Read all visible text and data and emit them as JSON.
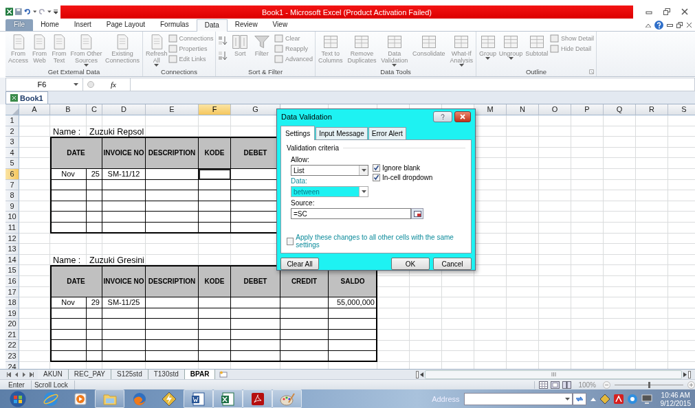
{
  "window": {
    "title": "Book1 - Microsoft Excel (Product Activation Failed)"
  },
  "ribbon": {
    "disabled": true,
    "tabs": [
      {
        "label": "File",
        "kind": "file",
        "selected": false
      },
      {
        "label": "Home",
        "kind": "tab",
        "selected": false
      },
      {
        "label": "Insert",
        "kind": "tab",
        "selected": false
      },
      {
        "label": "Page Layout",
        "kind": "tab",
        "selected": false
      },
      {
        "label": "Formulas",
        "kind": "tab",
        "selected": false
      },
      {
        "label": "Data",
        "kind": "tab",
        "selected": true
      },
      {
        "label": "Review",
        "kind": "tab",
        "selected": false
      },
      {
        "label": "View",
        "kind": "tab",
        "selected": false
      }
    ],
    "groups": [
      {
        "label": "Get External Data",
        "items": [
          {
            "kind": "large",
            "label": "From\nAccess"
          },
          {
            "kind": "large",
            "label": "From\nWeb"
          },
          {
            "kind": "large",
            "label": "From\nText"
          },
          {
            "kind": "large",
            "label": "From Other\nSources",
            "menu": true
          },
          {
            "kind": "large",
            "label": "Existing\nConnections"
          }
        ]
      },
      {
        "label": "Connections",
        "items": [
          {
            "kind": "large",
            "label": "Refresh\nAll",
            "menu": true
          },
          {
            "kind": "stack",
            "items": [
              {
                "label": "Connections"
              },
              {
                "label": "Properties"
              },
              {
                "label": "Edit Links"
              }
            ]
          }
        ]
      },
      {
        "label": "Sort & Filter",
        "items": [
          {
            "kind": "sort-icons"
          },
          {
            "kind": "large",
            "label": "Sort"
          },
          {
            "kind": "large",
            "label": "Filter"
          },
          {
            "kind": "stack",
            "items": [
              {
                "label": "Clear"
              },
              {
                "label": "Reapply"
              },
              {
                "label": "Advanced"
              }
            ]
          }
        ]
      },
      {
        "label": "Data Tools",
        "items": [
          {
            "kind": "large",
            "label": "Text to\nColumns"
          },
          {
            "kind": "large",
            "label": "Remove\nDuplicates"
          },
          {
            "kind": "large",
            "label": "Data\nValidation",
            "menu": true
          },
          {
            "kind": "large",
            "label": "Consolidate"
          },
          {
            "kind": "large",
            "label": "What-If\nAnalysis",
            "menu": true
          }
        ]
      },
      {
        "label": "Outline",
        "launcher": true,
        "items": [
          {
            "kind": "large",
            "label": "Group",
            "menu": true
          },
          {
            "kind": "large",
            "label": "Ungroup",
            "menu": true
          },
          {
            "kind": "large",
            "label": "Subtotal"
          },
          {
            "kind": "stack",
            "items": [
              {
                "label": "Show Detail"
              },
              {
                "label": "Hide Detail"
              }
            ]
          }
        ]
      }
    ]
  },
  "formula_bar": {
    "name_box": "F6",
    "function_label": "fx"
  },
  "workbook_tab": {
    "label": "Book1"
  },
  "sheet": {
    "columns_left": [
      {
        "label": "A",
        "selected": false
      },
      {
        "label": "B",
        "selected": false
      },
      {
        "label": "C",
        "selected": false
      },
      {
        "label": "D",
        "selected": false
      },
      {
        "label": "E",
        "selected": false
      },
      {
        "label": "F",
        "selected": true
      },
      {
        "label": "G",
        "selected": false
      }
    ],
    "columns_right": [
      {
        "label": "M",
        "selected": false
      },
      {
        "label": "N",
        "selected": false
      },
      {
        "label": "O",
        "selected": false
      },
      {
        "label": "P",
        "selected": false
      },
      {
        "label": "Q",
        "selected": false
      },
      {
        "label": "R",
        "selected": false
      },
      {
        "label": "S",
        "selected": false
      }
    ],
    "rows": [
      {
        "label": "1",
        "selected": false
      },
      {
        "label": "2",
        "selected": false
      },
      {
        "label": "3",
        "selected": false
      },
      {
        "label": "4",
        "selected": false
      },
      {
        "label": "5",
        "selected": false
      },
      {
        "label": "6",
        "selected": true
      },
      {
        "label": "7",
        "selected": false
      },
      {
        "label": "8",
        "selected": false
      },
      {
        "label": "9",
        "selected": false
      },
      {
        "label": "10",
        "selected": false
      },
      {
        "label": "11",
        "selected": false
      },
      {
        "label": "12",
        "selected": false
      },
      {
        "label": "13",
        "selected": false
      },
      {
        "label": "14",
        "selected": false
      },
      {
        "label": "15",
        "selected": false
      },
      {
        "label": "16",
        "selected": false
      },
      {
        "label": "17",
        "selected": false
      },
      {
        "label": "18",
        "selected": false
      },
      {
        "label": "19",
        "selected": false
      },
      {
        "label": "20",
        "selected": false
      },
      {
        "label": "21",
        "selected": false
      },
      {
        "label": "22",
        "selected": false
      },
      {
        "label": "23",
        "selected": false
      },
      {
        "label": "24",
        "selected": false
      }
    ],
    "tables": [
      {
        "name_label": "Name :",
        "name_value": "Zuzuki Repsol",
        "headers": [
          "DATE",
          "INVOICE NO",
          "DESCRIPTION",
          "KODE",
          "DEBET"
        ],
        "rows": [
          {
            "month": "Nov",
            "day": "25",
            "invoice": "SM-11/12"
          }
        ]
      },
      {
        "name_label": "Name :",
        "name_value": "Zuzuki Gresini",
        "headers": [
          "DATE",
          "INVOICE NO",
          "DESCRIPTION",
          "KODE",
          "DEBET",
          "CREDIT",
          "SALDO"
        ],
        "rows": [
          {
            "month": "Nov",
            "day": "29",
            "invoice": "SM-11/25",
            "saldo": "55,000,000"
          }
        ]
      }
    ]
  },
  "dialog": {
    "title": "Data Validation",
    "tabs": [
      {
        "label": "Settings",
        "selected": true
      },
      {
        "label": "Input Message",
        "selected": false
      },
      {
        "label": "Error Alert",
        "selected": false
      }
    ],
    "section": "Validation criteria",
    "allow": {
      "label": "Allow:",
      "value": "List"
    },
    "data": {
      "label": "Data:",
      "value": "between",
      "disabled": true
    },
    "source": {
      "label": "Source:",
      "value": "=SC"
    },
    "checkboxes": [
      {
        "label": "Ignore blank",
        "checked": true
      },
      {
        "label": "In-cell dropdown",
        "checked": true
      }
    ],
    "apply": {
      "label": "Apply these changes to all other cells with the same settings",
      "checked": false,
      "disabled": true
    },
    "buttons": [
      {
        "label": "Clear All",
        "kind": "left"
      },
      {
        "label": "OK",
        "kind": "right"
      },
      {
        "label": "Cancel",
        "kind": "right"
      }
    ]
  },
  "sheet_tabs": [
    {
      "label": "AKUN",
      "selected": false
    },
    {
      "label": "REC_PAY",
      "selected": false
    },
    {
      "label": "S125std",
      "selected": false
    },
    {
      "label": "T130std",
      "selected": false
    },
    {
      "label": "BPAR",
      "selected": true
    }
  ],
  "status_bar": {
    "items": [
      "Enter",
      "Scroll Lock"
    ],
    "zoom": {
      "label": "100%",
      "level": 0.5
    }
  },
  "taskbar": {
    "apps": [
      {
        "running": false
      },
      {
        "running": false
      },
      {
        "running": true
      },
      {
        "running": false
      },
      {
        "running": false
      },
      {
        "running": true
      },
      {
        "running": true
      },
      {
        "running": true
      },
      {
        "running": true
      }
    ],
    "address": {
      "label": "Address"
    },
    "clock": {
      "time": "10:46 AM",
      "date": "9/12/2015"
    }
  }
}
